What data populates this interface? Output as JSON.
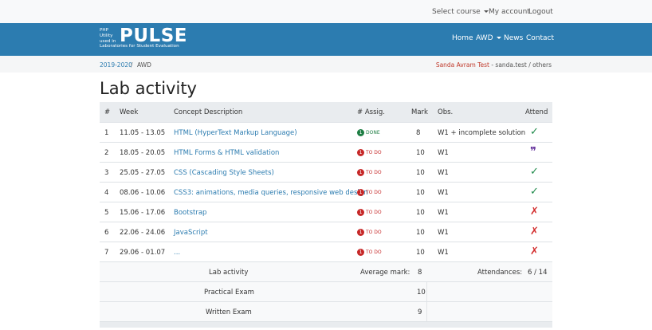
{
  "topbar": {
    "select_course": "Select course",
    "my_account": "My account",
    "logout": "Logout"
  },
  "logo": {
    "small_lines": [
      "PHP",
      "Utility",
      "used in"
    ],
    "big": "PULSE",
    "subtitle": "Laboratories for Student Evaluation"
  },
  "nav": {
    "home": "Home",
    "awd": "AWD",
    "news": "News",
    "contact": "Contact"
  },
  "breadcrumb": {
    "year": "2019-2020",
    "separator": "/",
    "course": "AWD"
  },
  "user": {
    "name": "Sanda Avram Test",
    "rest": " - sanda.test / others"
  },
  "page_title": "Lab activity",
  "table": {
    "headers": {
      "num": "#",
      "week": "Week",
      "concept": "Concept Description",
      "assig": "# Assig.",
      "mark": "Mark",
      "obs": "Obs.",
      "attend": "Attend"
    },
    "rows": [
      {
        "num": "1",
        "week": "11.05 - 13.05",
        "concept": "HTML (HyperText Markup Language)",
        "badge_count": "1",
        "status": "DONE",
        "mark": "8",
        "obs": "W1 + incomplete solution",
        "attend": "✓"
      },
      {
        "num": "2",
        "week": "18.05 - 20.05",
        "concept": "HTML Forms & HTML validation",
        "badge_count": "1",
        "status": "TO DO",
        "mark": "10",
        "obs": "W1",
        "attend": "❞"
      },
      {
        "num": "3",
        "week": "25.05 - 27.05",
        "concept": "CSS (Cascading Style Sheets)",
        "badge_count": "1",
        "status": "TO DO",
        "mark": "10",
        "obs": "W1",
        "attend": "✓"
      },
      {
        "num": "4",
        "week": "08.06 - 10.06",
        "concept": "CSS3: animations, media queries, responsive web design",
        "badge_count": "1",
        "status": "TO DO",
        "mark": "10",
        "obs": "W1",
        "attend": "✓"
      },
      {
        "num": "5",
        "week": "15.06 - 17.06",
        "concept": "Bootstrap",
        "badge_count": "1",
        "status": "TO DO",
        "mark": "10",
        "obs": "W1",
        "attend": "✗"
      },
      {
        "num": "6",
        "week": "22.06 - 24.06",
        "concept": "JavaScript",
        "badge_count": "1",
        "status": "TO DO",
        "mark": "10",
        "obs": "W1",
        "attend": "✗"
      },
      {
        "num": "7",
        "week": "29.06 - 01.07",
        "concept": "...",
        "badge_count": "1",
        "status": "TO DO",
        "mark": "10",
        "obs": "W1",
        "attend": "✗"
      }
    ]
  },
  "summary": {
    "lab_activity": "Lab activity",
    "average_label": "Average mark:",
    "average_value": "8",
    "attendances_label": "Attendances:",
    "attendances_value": "6 / 14",
    "practical_label": "Practical Exam",
    "practical_value": "10",
    "written_label": "Written Exam",
    "written_value": "9"
  },
  "colors": {
    "navbar": "#2c7cb0",
    "done": "#1e7e44",
    "todo": "#c62828",
    "link": "#2c7cb0"
  }
}
